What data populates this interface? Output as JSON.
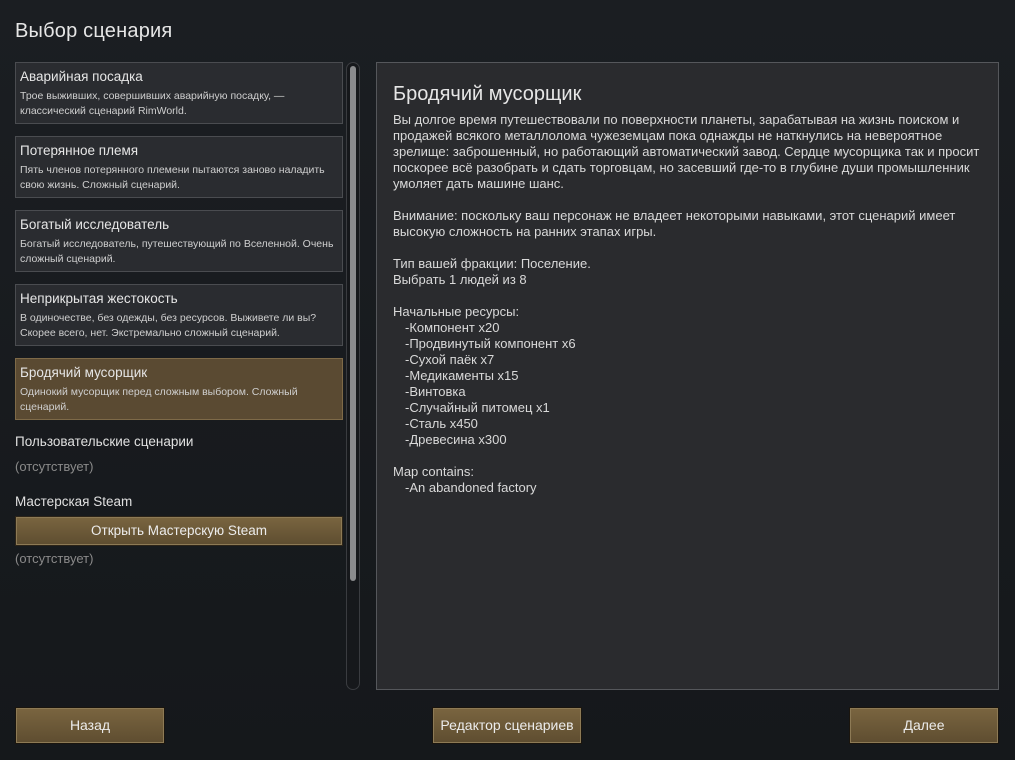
{
  "page": {
    "title": "Выбор сценария"
  },
  "scenarios": [
    {
      "title": "Аварийная посадка",
      "desc": "Трое выживших, совершивших аварийную посадку, — классический сценарий RimWorld.",
      "selected": false
    },
    {
      "title": "Потерянное племя",
      "desc": "Пять членов потерянного племени пытаются заново наладить свою жизнь. Сложный сценарий.",
      "selected": false
    },
    {
      "title": "Богатый исследователь",
      "desc": "Богатый исследователь, путешествующий по Вселенной. Очень сложный сценарий.",
      "selected": false
    },
    {
      "title": "Неприкрытая жестокость",
      "desc": "В одиночестве, без одежды, без ресурсов. Выживете ли вы? Скорее всего, нет. Экстремально сложный сценарий.",
      "selected": false
    },
    {
      "title": "Бродячий мусорщик",
      "desc": "Одинокий мусорщик перед сложным выбором. Сложный сценарий.",
      "selected": true
    }
  ],
  "custom_section": {
    "label": "Пользовательские сценарии",
    "empty": "(отсутствует)"
  },
  "steam_section": {
    "label": "Мастерская Steam",
    "button": "Открыть Мастерскую Steam",
    "empty": "(отсутствует)"
  },
  "detail": {
    "title": "Бродячий мусорщик",
    "description": "Вы долгое время путешествовали по поверхности планеты, зарабатывая на жизнь поиском и продажей всякого металлолома чужеземцам пока однажды не наткнулись на невероятное зрелище: заброшенный, но работающий автоматический завод. Сердце мусорщика так и просит поскорее всё разобрать и сдать торговцам, но засевший где-то в глубине души промышленник умоляет дать машине шанс.",
    "warning": "Внимание: поскольку ваш персонаж не владеет некоторыми навыками, этот сценарий имеет высокую сложность на ранних этапах игры.",
    "faction_type": "Тип вашей фракции: Поселение.",
    "pick": "Выбрать 1 людей из 8",
    "resources_label": "Начальные ресурсы:",
    "resources": [
      "-Компонент x20",
      "-Продвинутый компонент x6",
      "-Сухой паёк x7",
      "-Медикаменты x15",
      "-Винтовка",
      "-Случайный питомец x1",
      "-Сталь x450",
      "-Древесина x300"
    ],
    "map_label": "Map contains:",
    "map_items": [
      "-An abandoned factory"
    ]
  },
  "buttons": {
    "back": "Назад",
    "editor": "Редактор сценариев",
    "next": "Далее"
  },
  "colors": {
    "background": "#1b1e22",
    "selected_item": "#5a4a32",
    "button": "#6c5938",
    "panel": "#2a2b2e"
  }
}
